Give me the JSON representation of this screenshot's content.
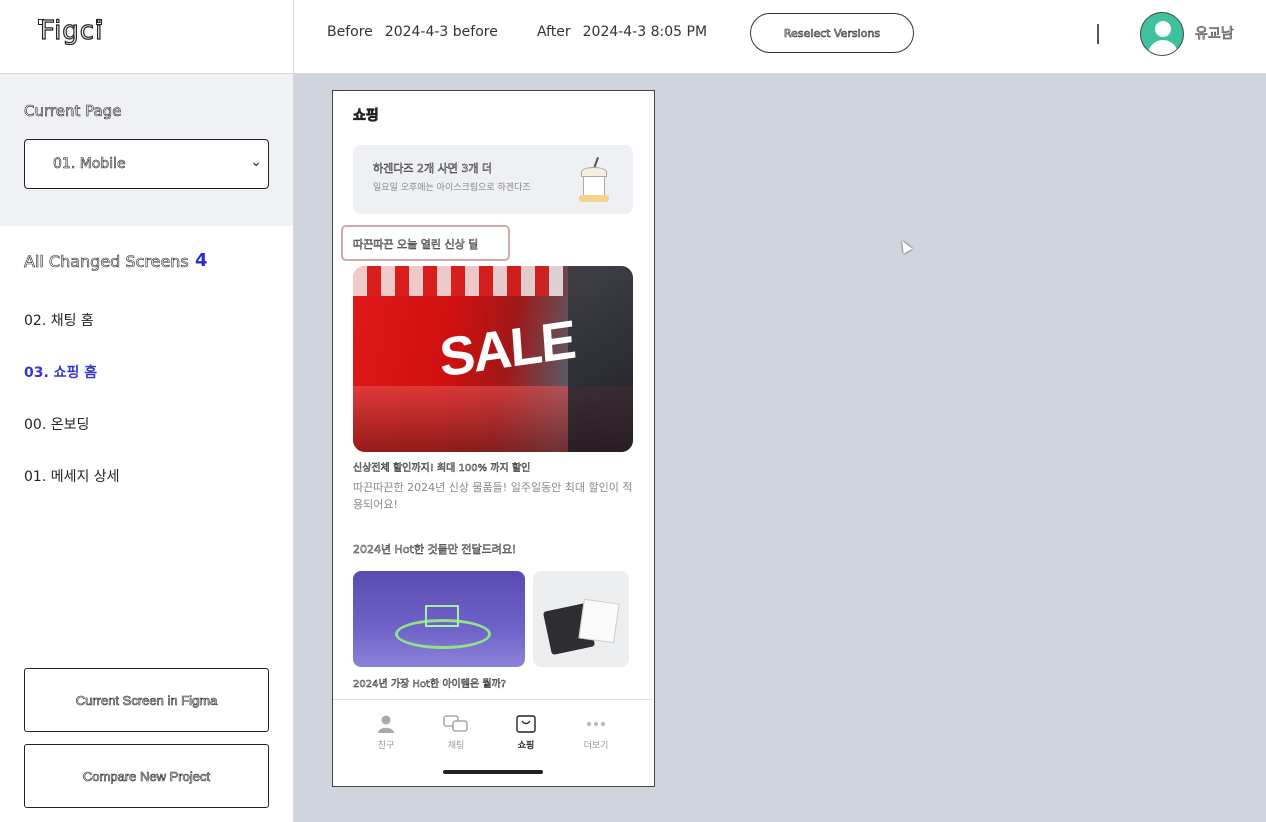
{
  "header": {
    "logo": "Figci",
    "before_label": "Before",
    "before_value": "2024-4-3 before",
    "after_label": "After",
    "after_value": "2024-4-3 8:05 PM",
    "reselect_label": "Reselect Versions",
    "username": "유교남"
  },
  "sidebar": {
    "current_page_label": "Current Page",
    "current_page_value": "01. Mobile",
    "changed_label": "All Changed Screens",
    "changed_count": "4",
    "screens": [
      {
        "label": "02. 채팅 홈"
      },
      {
        "label": "03. 쇼핑 홈"
      },
      {
        "label": "00. 온보딩"
      },
      {
        "label": "01. 메세지 상세"
      }
    ],
    "btn_current_screen": "Current Screen in Figma",
    "btn_compare_new": "Compare New Project"
  },
  "phone": {
    "title": "쇼핑",
    "banner_title": "하겐다즈 2개 사면 3개 더",
    "banner_sub": "일요일 오후에는 아이스크림으로 하겐다즈",
    "section1": "따끈따끈 오늘 열린 신상 딜",
    "sale_text": "SALE",
    "product_title": "신상전체 할인까지! 최대 100% 까지 할인",
    "product_desc": "따끈따끈한 2024년 신상 물품들! 일주일동안 최대 할인이 적용되어요!",
    "section2": "2024년 Hot한 것들만 전달드려요!",
    "product2_title": "2024년 가장 Hot한 아이템은 뭘까?",
    "tabs": [
      {
        "label": "친구",
        "icon": "person-icon"
      },
      {
        "label": "채팅",
        "icon": "chat-icon"
      },
      {
        "label": "쇼핑",
        "icon": "shopping-bag-icon"
      },
      {
        "label": "더보기",
        "icon": "more-icon"
      }
    ]
  },
  "colors": {
    "accent": "#3636c9",
    "highlight_border": "#d4a9ad",
    "canvas_bg": "#d0d4dc",
    "avatar": "#3fc19f"
  }
}
